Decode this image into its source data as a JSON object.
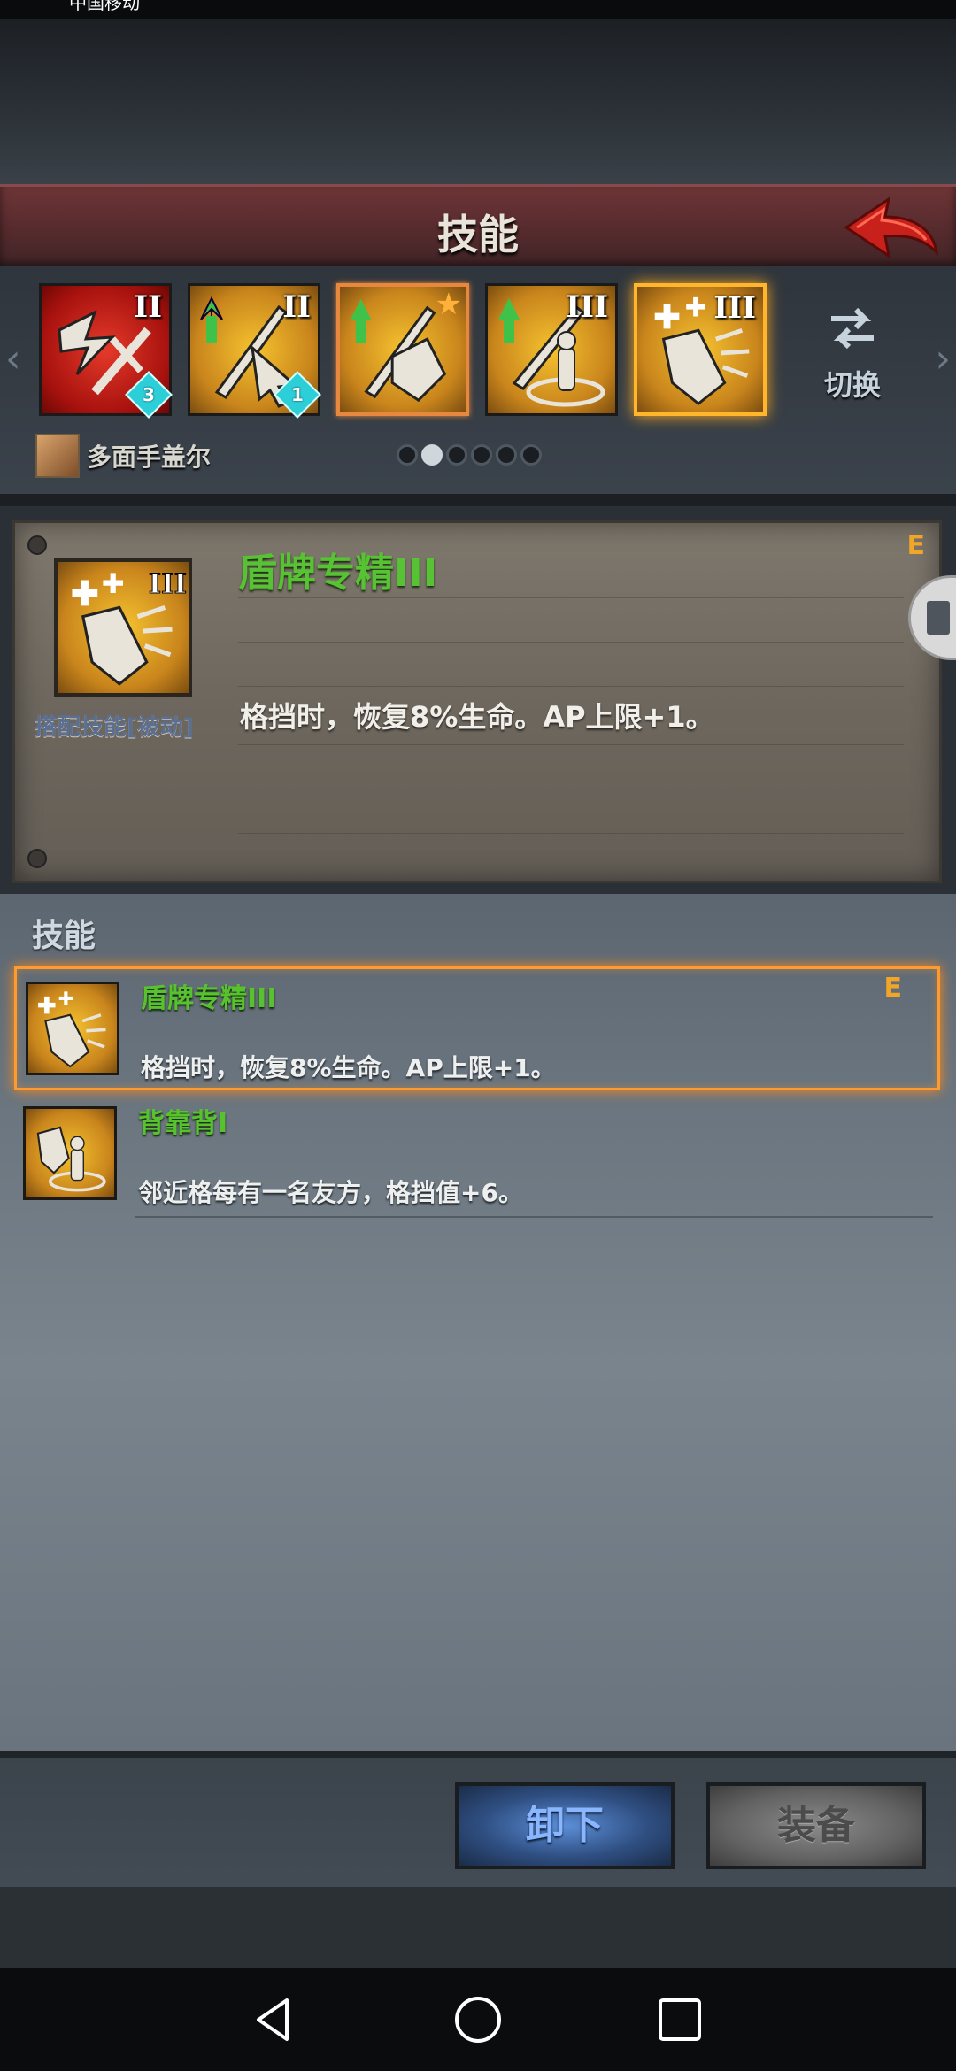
{
  "status_bar": {
    "carrier": "中国移动",
    "right": ""
  },
  "header": {
    "title": "技能"
  },
  "skill_slots": [
    {
      "rank": "II",
      "gem": "3"
    },
    {
      "rank": "II",
      "gem": "1"
    },
    {
      "rank": "",
      "gem": ""
    },
    {
      "rank": "III",
      "gem": ""
    },
    {
      "rank": "III",
      "gem": ""
    }
  ],
  "switch_label": "切换",
  "hero": {
    "name": "多面手盖尔"
  },
  "pager": {
    "count": 6,
    "active_index": 1
  },
  "detail": {
    "name": "盾牌专精III",
    "grade": "E",
    "rank": "III",
    "kind": "搭配技能[被动]",
    "description": "格挡时，恢复8%生命。AP上限+1。"
  },
  "list": {
    "title": "技能",
    "items": [
      {
        "name": "盾牌专精III",
        "grade": "E",
        "description": "格挡时，恢复8%生命。AP上限+1。",
        "selected": true
      },
      {
        "name": "背靠背I",
        "grade": "",
        "description": "邻近格每有一名友方，格挡值+6。",
        "selected": false
      }
    ]
  },
  "buttons": {
    "unequip": "卸下",
    "equip": "装备"
  },
  "colors": {
    "skill_name_green": "#58c22e",
    "grade_orange": "#f2a628",
    "header_red": "#6d3537"
  },
  "icons": [
    "back-arrow-icon",
    "switch-arrows-icon",
    "nav-back-icon",
    "nav-home-icon",
    "nav-recents-icon"
  ]
}
